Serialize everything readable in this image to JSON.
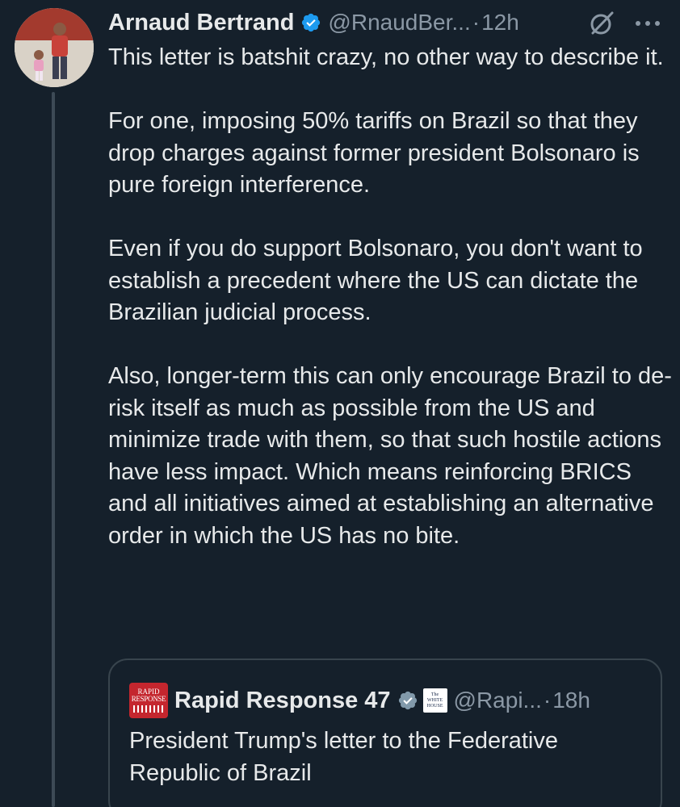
{
  "tweet": {
    "author_name": "Arnaud Bertrand",
    "handle": "@RnaudBer...",
    "separator": "·",
    "time": "12h",
    "paragraphs": [
      "This letter is batshit crazy, no other way to describe it.",
      "For one, imposing 50% tariffs on Brazil so that they drop charges against former president Bolsonaro is pure foreign interference.",
      "Even if you do support Bolsonaro, you don't want to establish a precedent where the US can dictate the Brazilian judicial process.",
      "Also, longer-term this can only encourage Brazil to de-risk itself as much as possible from the US and minimize trade with them, so that such hostile actions have less impact. Which means reinforcing BRICS and all initiatives aimed at establishing an alternative order in which the US has no bite."
    ]
  },
  "quote": {
    "logo_line1": "RAPID",
    "logo_line2": "RESPONSE",
    "author_name": "Rapid Response 47",
    "affiliate_badge_line1": "The",
    "affiliate_badge_line2": "WHITE",
    "affiliate_badge_line3": "HOUSE",
    "handle": "@Rapi...",
    "separator": "·",
    "time": "18h",
    "text": "President Trump's letter to the Federative Republic of Brazil"
  },
  "icons": {
    "verified": "verified-badge-icon",
    "grok": "grok-icon",
    "more": "more-options-icon"
  },
  "colors": {
    "background": "#15202b",
    "text": "#e7e9ea",
    "secondary_text": "#8b98a5",
    "verified_blue": "#1d9bf0",
    "quote_verified_gray": "#829aab",
    "rapid_response_red": "#c4262e"
  }
}
